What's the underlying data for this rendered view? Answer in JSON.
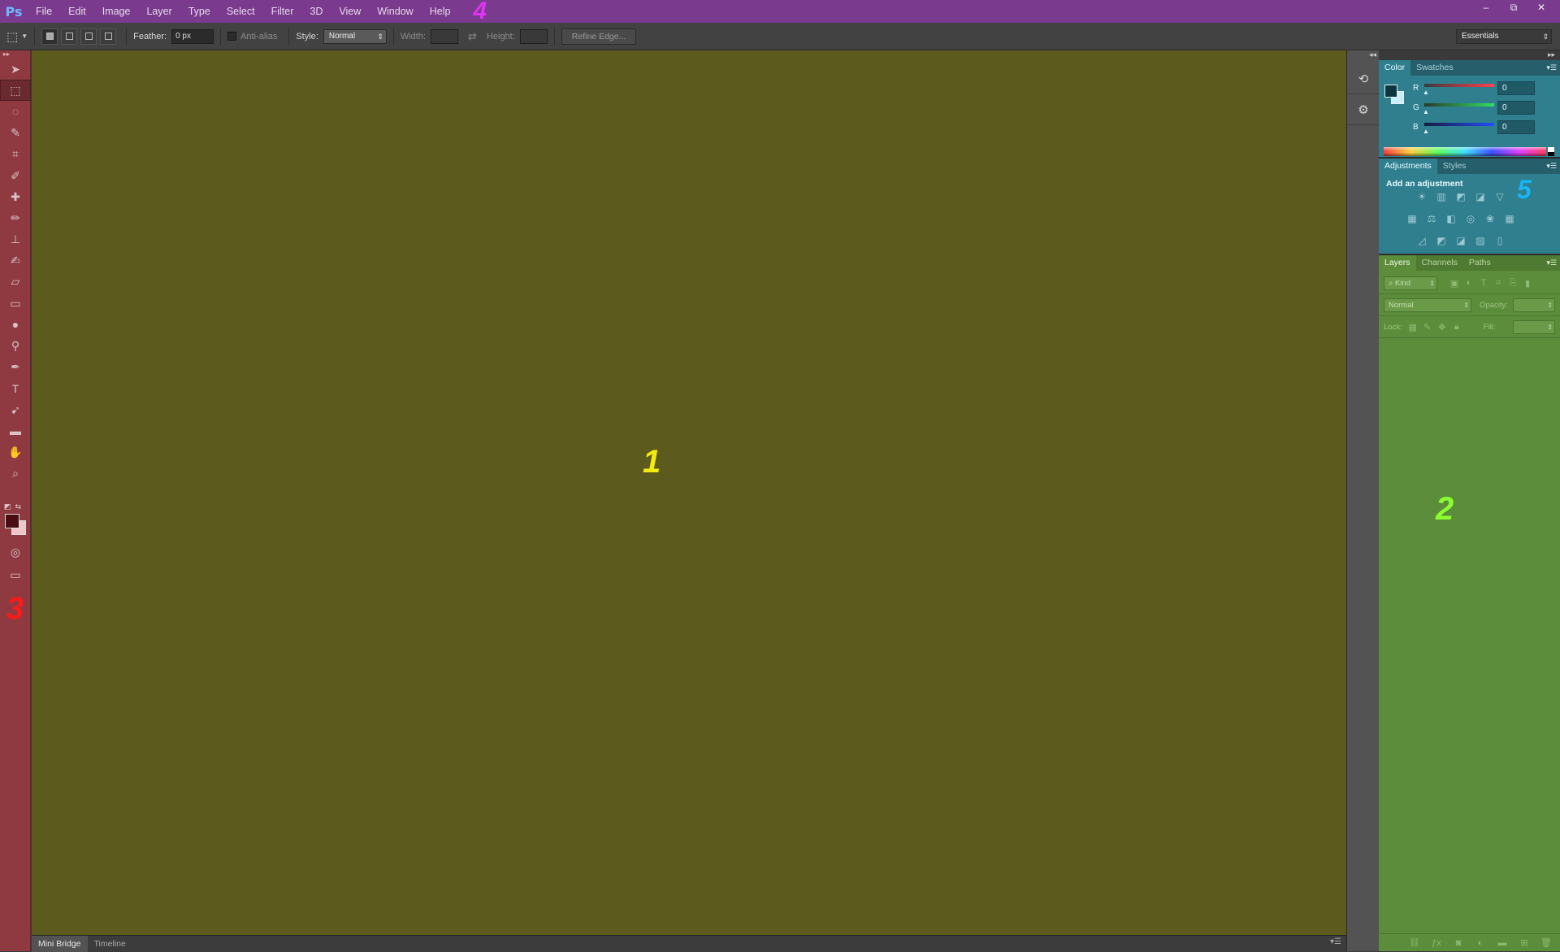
{
  "app": {
    "logo": "Ps"
  },
  "menu": {
    "items": [
      "File",
      "Edit",
      "Image",
      "Layer",
      "Type",
      "Select",
      "Filter",
      "3D",
      "View",
      "Window",
      "Help"
    ],
    "marker": "4"
  },
  "window_controls": {
    "minimize": "–",
    "restore": "⧉",
    "close": "✕"
  },
  "options_bar": {
    "feather_label": "Feather:",
    "feather_value": "0 px",
    "antialias_label": "Anti-alias",
    "style_label": "Style:",
    "style_value": "Normal",
    "width_label": "Width:",
    "height_label": "Height:",
    "refine_edge_label": "Refine Edge...",
    "workspace_value": "Essentials"
  },
  "toolbar": {
    "marker": "3",
    "tools": [
      {
        "name": "move-tool-icon",
        "glyph": "➤"
      },
      {
        "name": "marquee-tool-icon",
        "glyph": "⬚"
      },
      {
        "name": "lasso-tool-icon",
        "glyph": "◌"
      },
      {
        "name": "quick-selection-tool-icon",
        "glyph": "✎"
      },
      {
        "name": "crop-tool-icon",
        "glyph": "⌗"
      },
      {
        "name": "eyedropper-tool-icon",
        "glyph": "✐"
      },
      {
        "name": "healing-brush-tool-icon",
        "glyph": "✚"
      },
      {
        "name": "brush-tool-icon",
        "glyph": "✏"
      },
      {
        "name": "clone-stamp-tool-icon",
        "glyph": "⊥"
      },
      {
        "name": "history-brush-tool-icon",
        "glyph": "✍"
      },
      {
        "name": "eraser-tool-icon",
        "glyph": "▱"
      },
      {
        "name": "gradient-tool-icon",
        "glyph": "▭"
      },
      {
        "name": "blur-tool-icon",
        "glyph": "●"
      },
      {
        "name": "dodge-tool-icon",
        "glyph": "⚲"
      },
      {
        "name": "pen-tool-icon",
        "glyph": "✒"
      },
      {
        "name": "type-tool-icon",
        "glyph": "T"
      },
      {
        "name": "path-selection-tool-icon",
        "glyph": "➹"
      },
      {
        "name": "shape-tool-icon",
        "glyph": "▬"
      },
      {
        "name": "hand-tool-icon",
        "glyph": "✋"
      },
      {
        "name": "zoom-tool-icon",
        "glyph": "⌕"
      }
    ]
  },
  "workspace": {
    "marker": "1"
  },
  "bottom_tabs": [
    "Mini Bridge",
    "Timeline"
  ],
  "color_panel": {
    "tabs": [
      "Color",
      "Swatches"
    ],
    "channels": [
      {
        "label": "R",
        "value": "0",
        "gradient": "linear-gradient(to right, #3a3a3a, #ff4050)"
      },
      {
        "label": "G",
        "value": "0",
        "gradient": "linear-gradient(to right, #2a3a2a, #30e060)"
      },
      {
        "label": "B",
        "value": "0",
        "gradient": "linear-gradient(to right, #1a1a3a, #2050ff)"
      }
    ]
  },
  "adjustments_panel": {
    "tabs": [
      "Adjustments",
      "Styles"
    ],
    "title": "Add an adjustment",
    "marker": "5",
    "rows": [
      [
        "☀",
        "▥",
        "◩",
        "◪",
        "▽"
      ],
      [
        "▦",
        "⚖",
        "◧",
        "◎",
        "❀",
        "▦"
      ],
      [
        "◿",
        "◩",
        "◪",
        "▨",
        "▯"
      ]
    ]
  },
  "layers_panel": {
    "tabs": [
      "Layers",
      "Channels",
      "Paths"
    ],
    "filter_value": "Kind",
    "blend_value": "Normal",
    "opacity_label": "Opacity:",
    "lock_label": "Lock:",
    "fill_label": "Fill:",
    "marker": "2"
  }
}
